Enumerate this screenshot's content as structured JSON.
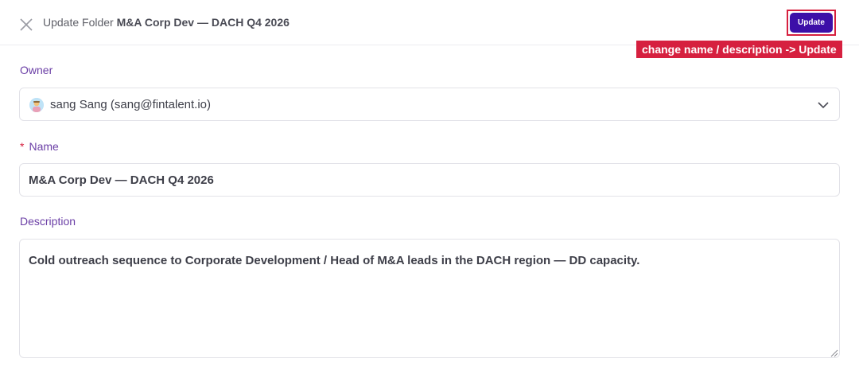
{
  "header": {
    "title_prefix": "Update Folder ",
    "folder_name": "M&A Corp Dev — DACH Q4 2026",
    "update_label": "Update"
  },
  "annotation": {
    "text": "change name / description -> Update",
    "color": "#d6203f"
  },
  "form": {
    "owner": {
      "label": "Owner",
      "value": "sang Sang (sang@fintalent.io)"
    },
    "name": {
      "label": "Name",
      "required_mark": "*",
      "value": "M&A Corp Dev — DACH Q4 2026"
    },
    "description": {
      "label": "Description",
      "value": "Cold outreach sequence to Corporate Development / Head of M&A leads in the DACH region — DD capacity."
    }
  },
  "icons": {
    "close": "close-icon",
    "chevron": "chevron-down-icon",
    "avatar": "avatar"
  },
  "colors": {
    "primary": "#3c0fa8",
    "label": "#6b3fa6",
    "required": "#d6203f"
  }
}
